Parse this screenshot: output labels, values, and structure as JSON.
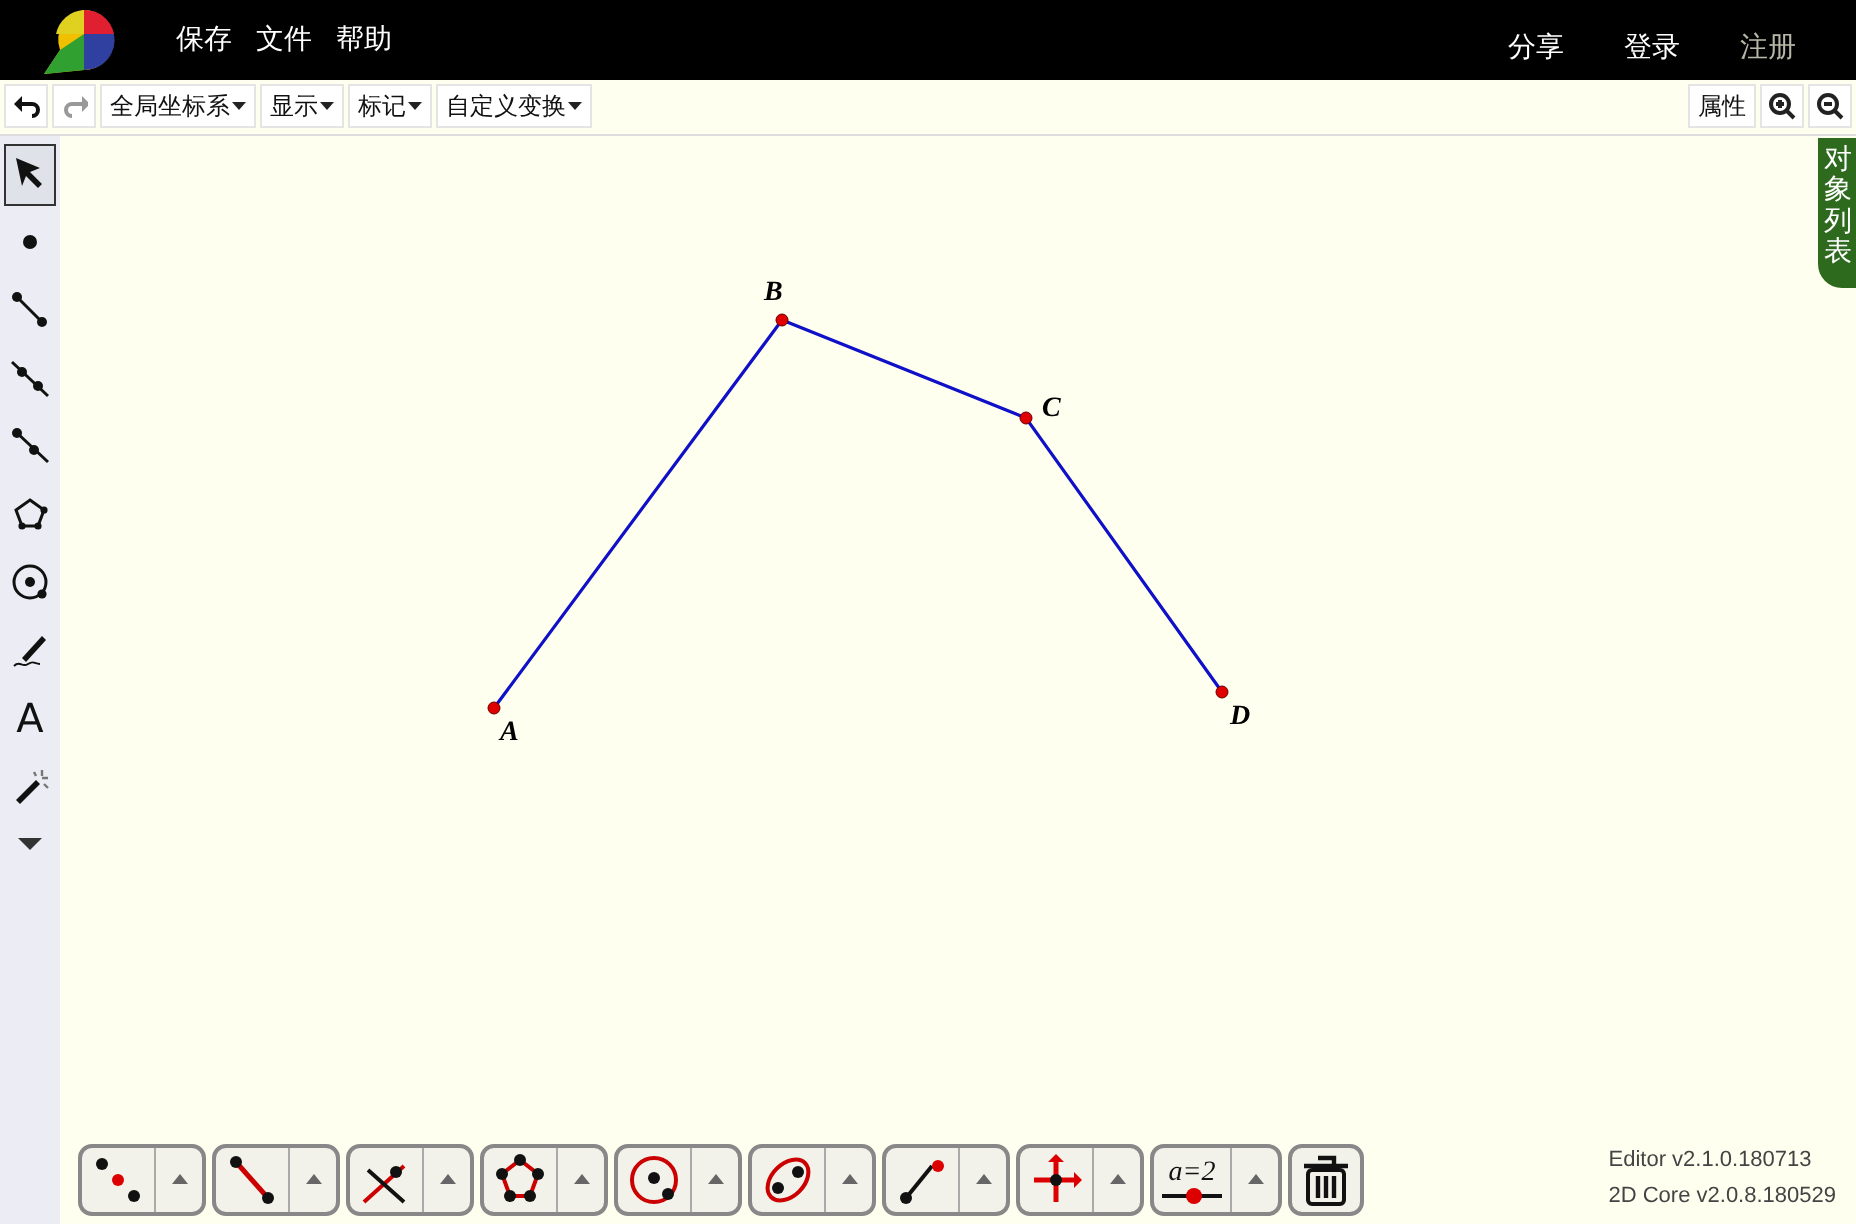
{
  "menu": {
    "items": [
      "保存",
      "文件",
      "帮助"
    ]
  },
  "account": [
    {
      "label": "分享",
      "muted": false
    },
    {
      "label": "登录",
      "muted": false
    },
    {
      "label": "注册",
      "muted": true
    }
  ],
  "toolbar": {
    "actions": [
      {
        "kind": "undo"
      },
      {
        "kind": "redo"
      }
    ],
    "dropdowns": [
      "全局坐标系",
      "显示",
      "标记",
      "自定义变换"
    ],
    "properties_button": "属性",
    "zoom": [
      {
        "kind": "zoom-in"
      },
      {
        "kind": "zoom-out"
      }
    ]
  },
  "tools": [
    {
      "kind": "pointer",
      "selected": true
    },
    {
      "kind": "point",
      "selected": false
    },
    {
      "kind": "segment",
      "selected": false
    },
    {
      "kind": "line",
      "selected": false
    },
    {
      "kind": "ray",
      "selected": false
    },
    {
      "kind": "polygon",
      "selected": false
    },
    {
      "kind": "circle",
      "selected": false
    },
    {
      "kind": "pen",
      "selected": false
    },
    {
      "kind": "text",
      "label": "A",
      "selected": false
    },
    {
      "kind": "wand",
      "selected": false
    },
    {
      "kind": "more",
      "selected": false
    }
  ],
  "figure": {
    "points": [
      {
        "label": "A"
      },
      {
        "label": "B"
      },
      {
        "label": "C"
      },
      {
        "label": "D"
      }
    ]
  },
  "object_list_tab": "对象列表",
  "bottom_tools": [
    {
      "kind": "points"
    },
    {
      "kind": "segment"
    },
    {
      "kind": "intersect"
    },
    {
      "kind": "polygon"
    },
    {
      "kind": "circle"
    },
    {
      "kind": "ellipse"
    },
    {
      "kind": "ray"
    },
    {
      "kind": "axes"
    },
    {
      "kind": "slider",
      "label": "a=2"
    },
    {
      "kind": "trash"
    }
  ],
  "version": [
    "Editor v2.1.0.180713",
    "2D Core v2.0.8.180529"
  ]
}
